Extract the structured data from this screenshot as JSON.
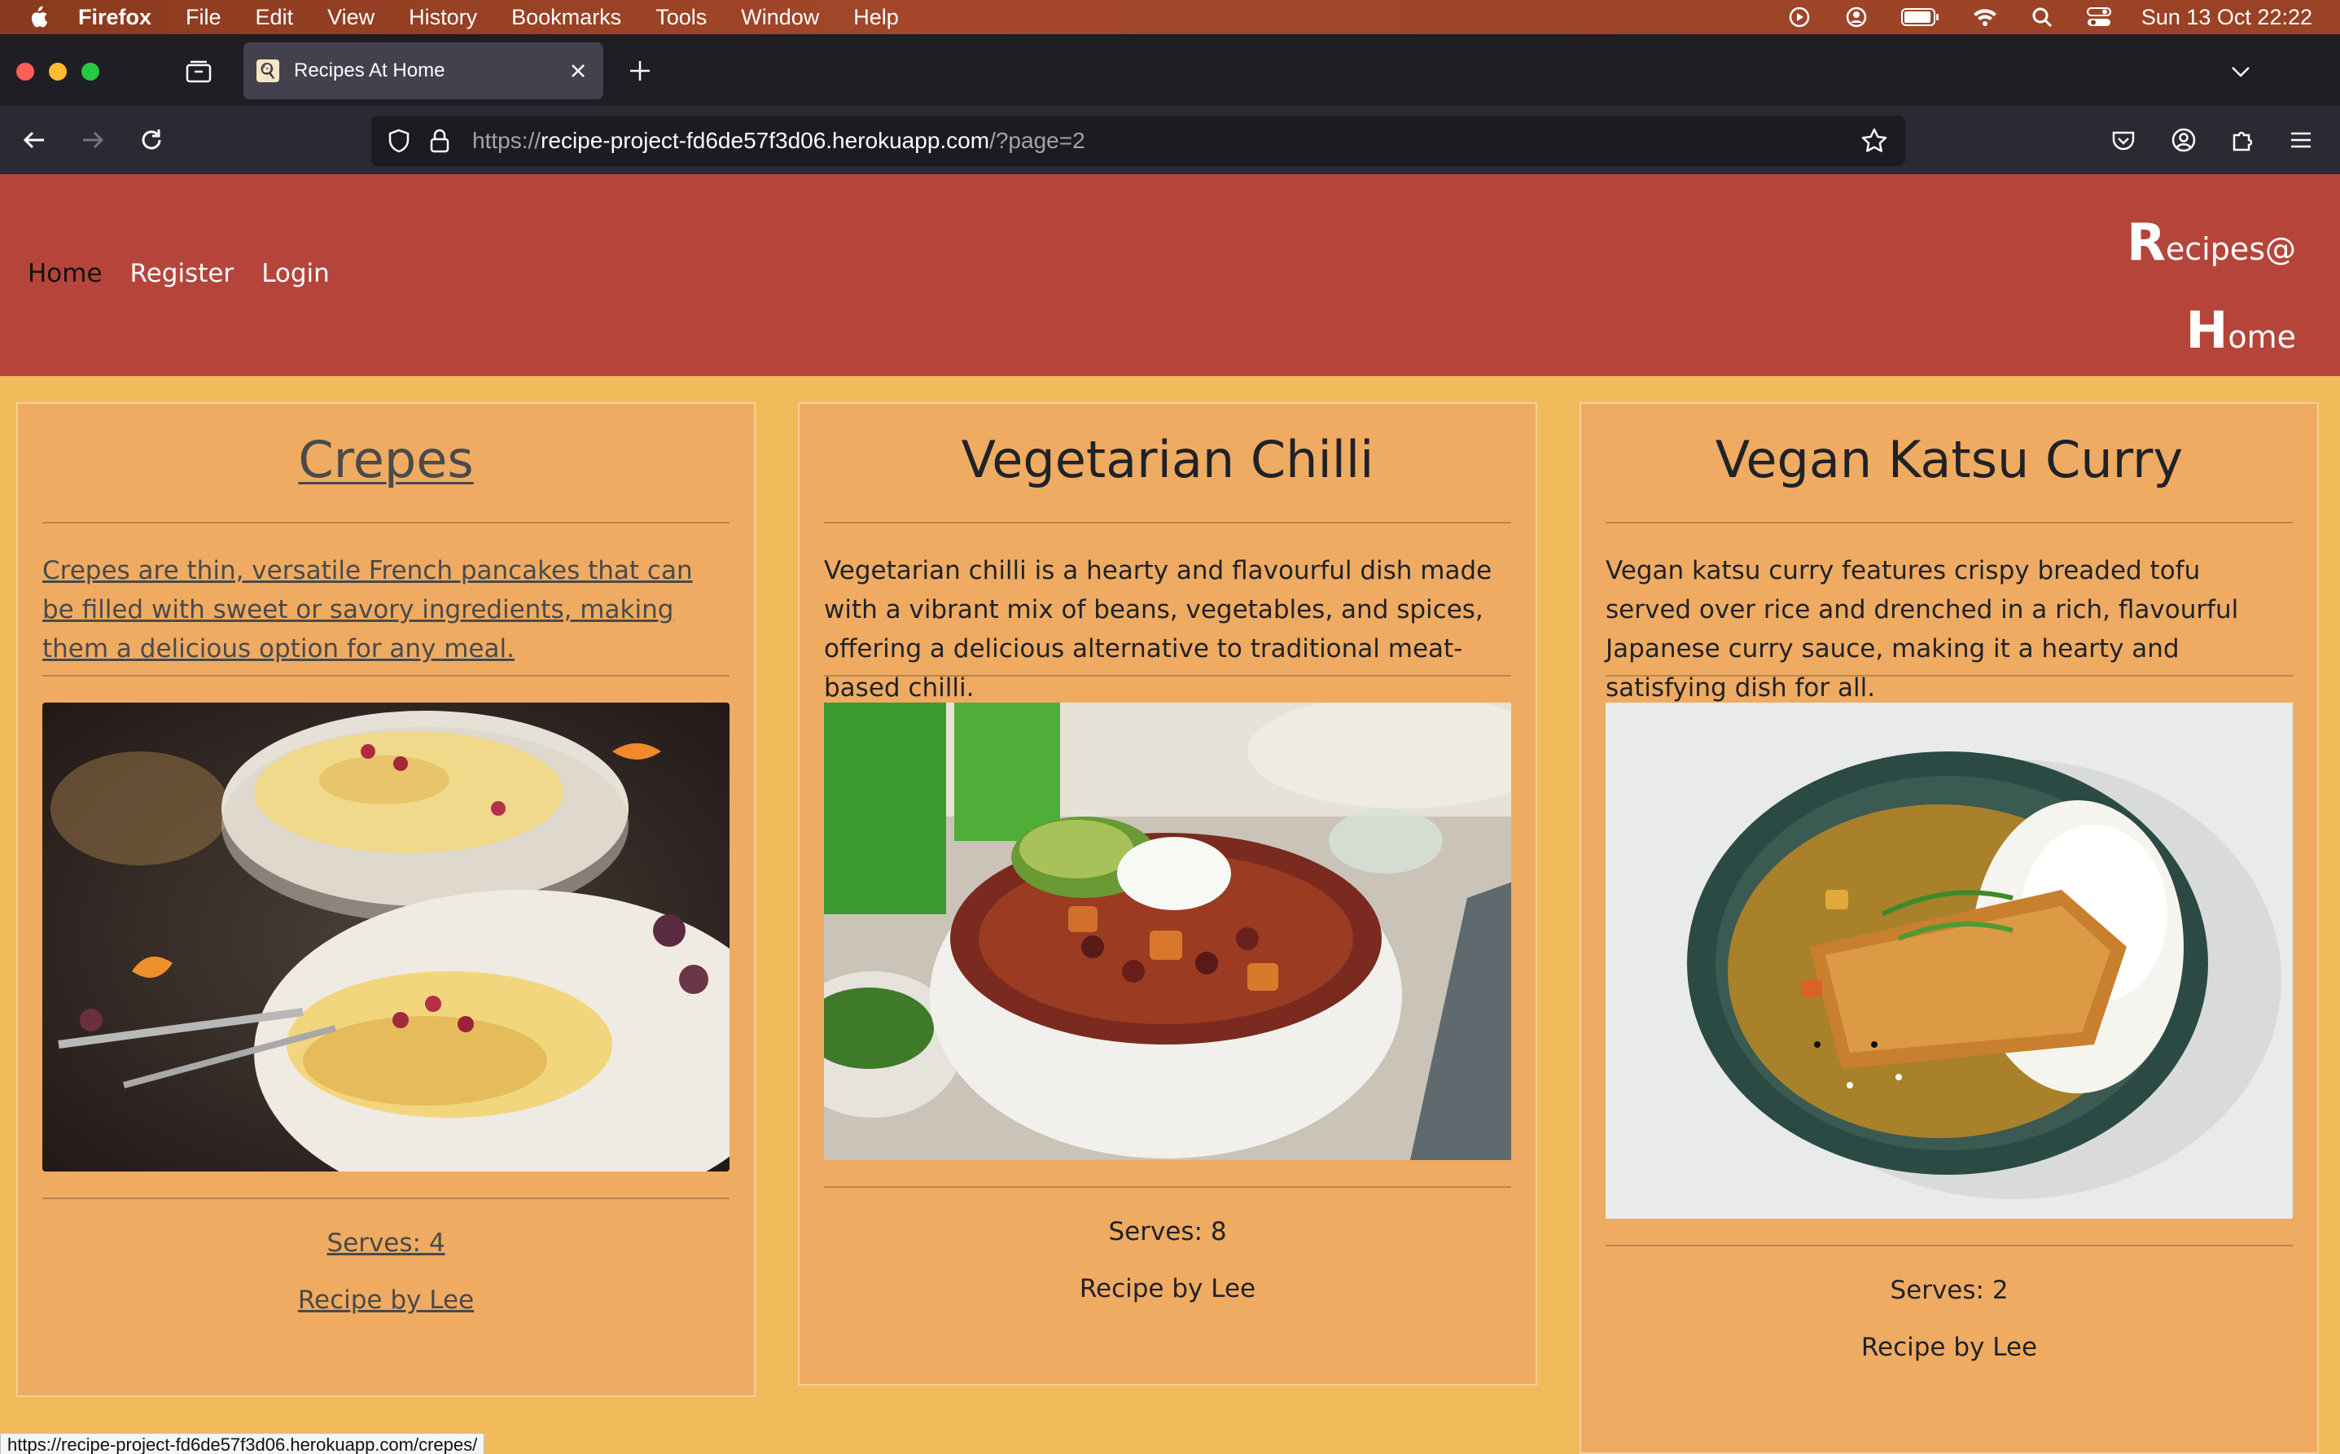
{
  "menubar": {
    "app": "Firefox",
    "items": [
      "File",
      "Edit",
      "View",
      "History",
      "Bookmarks",
      "Tools",
      "Window",
      "Help"
    ],
    "clock": "Sun 13 Oct  22:22"
  },
  "browser": {
    "tab_title": "Recipes At Home",
    "url_prefix": "https://",
    "url_host": "recipe-project-fd6de57f3d06.herokuapp.com",
    "url_path": "/?page=2",
    "status_url": "https://recipe-project-fd6de57f3d06.herokuapp.com/crepes/"
  },
  "site": {
    "nav": [
      "Home",
      "Register",
      "Login"
    ],
    "brand_line1_cap": "R",
    "brand_line1_rest": "ecipes@",
    "brand_line2_cap": "H",
    "brand_line2_rest": "ome"
  },
  "recipes": [
    {
      "title": "Crepes",
      "description": "Crepes are thin, versatile French pancakes that can be filled with sweet or savory ingredients, making them a delicious option for any meal.",
      "serves": "Serves: 4",
      "author": "Recipe by Lee"
    },
    {
      "title": "Vegetarian Chilli",
      "description": "Vegetarian chilli is a hearty and flavourful dish made with a vibrant mix of beans, vegetables, and spices, offering a delicious alternative to traditional meat-based chilli.",
      "serves": "Serves: 8",
      "author": "Recipe by Lee"
    },
    {
      "title": "Vegan Katsu Curry",
      "description": "Vegan katsu curry features crispy breaded tofu served over rice and drenched in a rich, flavourful Japanese curry sauce, making it a hearty and satisfying dish for all.",
      "serves": "Serves: 2",
      "author": "Recipe by Lee"
    }
  ]
}
